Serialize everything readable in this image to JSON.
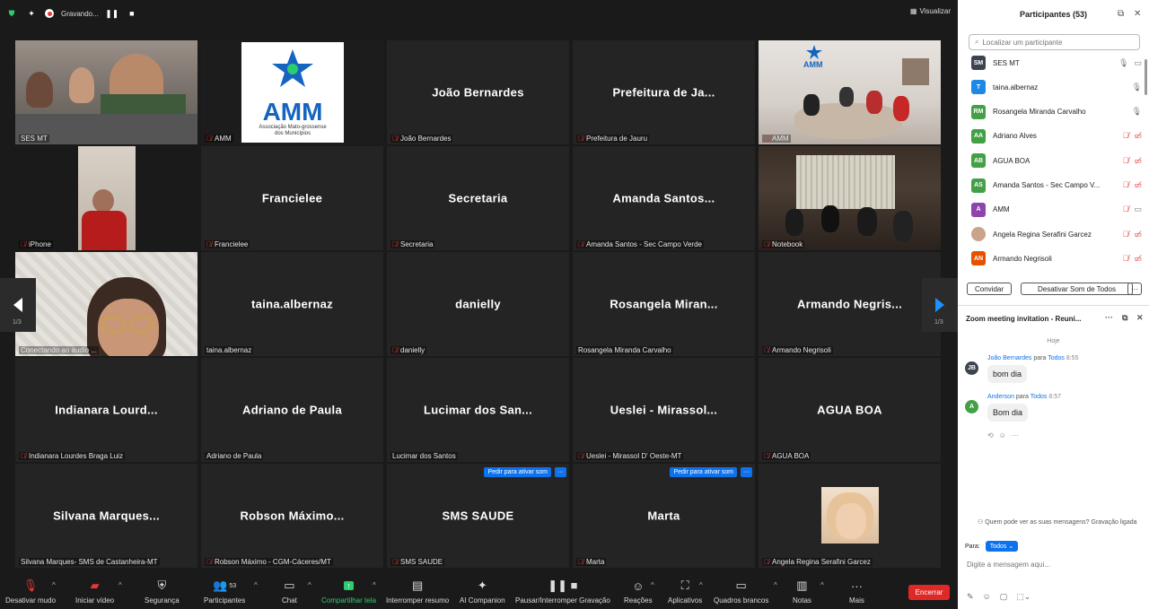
{
  "topbar": {
    "recording_label": "Gravando...",
    "view_label": "Visualizar"
  },
  "grid": {
    "tiles": [
      {
        "name": "",
        "label": "SES MT",
        "muted": false,
        "kind": "video-room"
      },
      {
        "name": "",
        "label": "AMM",
        "muted": true,
        "kind": "logo"
      },
      {
        "name": "João Bernardes",
        "label": "João Bernardes",
        "muted": true
      },
      {
        "name": "Prefeitura de Ja...",
        "label": "Prefeitura de Jauru",
        "muted": true
      },
      {
        "name": "",
        "label": "AMM",
        "muted": true,
        "kind": "video-office"
      },
      {
        "name": "",
        "label": "iPhone",
        "muted": true,
        "kind": "video-person"
      },
      {
        "name": "Francielee",
        "label": "Francielee",
        "muted": true
      },
      {
        "name": "Secretaria",
        "label": "Secretaria",
        "muted": true
      },
      {
        "name": "Amanda Santos...",
        "label": "Amanda Santos - Sec Campo Verde",
        "muted": true
      },
      {
        "name": "",
        "label": "Notebook",
        "muted": true,
        "kind": "video-dark"
      },
      {
        "name": "",
        "label": "Conectando ao áudio ...",
        "muted": false,
        "kind": "video-glasses"
      },
      {
        "name": "taina.albernaz",
        "label": "taina.albernaz",
        "muted": false
      },
      {
        "name": "danielly",
        "label": "danielly",
        "muted": true
      },
      {
        "name": "Rosangela Miran...",
        "label": "Rosangela Miranda Carvalho",
        "muted": false
      },
      {
        "name": "Armando Negris...",
        "label": "Armando Negrisoli",
        "muted": true
      },
      {
        "name": "Indianara Lourd...",
        "label": "Indianara Lourdes Braga Luiz",
        "muted": true
      },
      {
        "name": "Adriano de Paula",
        "label": "Adriano de Paula",
        "muted": false
      },
      {
        "name": "Lucimar dos San...",
        "label": "Lucimar dos Santos",
        "muted": false
      },
      {
        "name": "Ueslei - Mirassol...",
        "label": "Ueslei - Mirassol D' Oeste-MT",
        "muted": true
      },
      {
        "name": "AGUA BOA",
        "label": "AGUA BOA",
        "muted": true
      },
      {
        "name": "Silvana Marques...",
        "label": "Silvana Marques- SMS de Castanheira-MT",
        "muted": false
      },
      {
        "name": "Robson Máximo...",
        "label": "Robson Máximo - CGM-Cáceres/MT",
        "muted": true
      },
      {
        "name": "SMS SAUDE",
        "label": "SMS SAUDE",
        "muted": true,
        "request": true
      },
      {
        "name": "Marta",
        "label": "Marta",
        "muted": true,
        "request": true
      },
      {
        "name": "",
        "label": "Angela Regina Serafini Garcez",
        "muted": true,
        "kind": "photo"
      }
    ],
    "request_label": "Pedir para ativar som",
    "request_more": "···",
    "page_indicator": "1/3",
    "logo_text": "AMM",
    "logo_sub1": "Associação Mato-grossense",
    "logo_sub2": "dos Municípios"
  },
  "toolbar": {
    "mute": "Desativar mudo",
    "video": "Iniciar vídeo",
    "security": "Segurança",
    "participants": "Participantes",
    "participants_count": "53",
    "chat": "Chat",
    "share": "Compartilhar tela",
    "summary": "Interromper resumo",
    "companion": "AI Companion",
    "pause_recording": "Pausar/Interromper Gravação",
    "reactions": "Reações",
    "apps": "Aplicativos",
    "whiteboards": "Quadros brancos",
    "notes": "Notas",
    "more": "Mais",
    "end": "Encerrar"
  },
  "panel": {
    "title": "Participantes (53)",
    "search_placeholder": "Localizar um participante",
    "participants": [
      {
        "initials": "SM",
        "name": "SES MT",
        "color": "#3d4450",
        "mic": "on",
        "cam": "on"
      },
      {
        "initials": "T",
        "name": "taina.albernaz",
        "color": "#1e88e5",
        "mic": "on",
        "cam": ""
      },
      {
        "initials": "RM",
        "name": "Rosangela Miranda Carvalho",
        "color": "#43a047",
        "mic": "on",
        "cam": ""
      },
      {
        "initials": "AA",
        "name": "Adriano Alves",
        "color": "#43a047",
        "mic": "off",
        "cam": "off"
      },
      {
        "initials": "AB",
        "name": "AGUA BOA",
        "color": "#43a047",
        "mic": "off",
        "cam": "off"
      },
      {
        "initials": "AS",
        "name": "Amanda Santos - Sec Campo V...",
        "color": "#43a047",
        "mic": "off",
        "cam": "off"
      },
      {
        "initials": "A",
        "name": "AMM",
        "color": "#8e44ad",
        "mic": "off",
        "cam": "on"
      },
      {
        "initials": "",
        "name": "Angela Regina Serafini Garcez",
        "color": "#c9a38a",
        "mic": "off",
        "cam": "off"
      },
      {
        "initials": "AN",
        "name": "Armando Negrisoli",
        "color": "#e65100",
        "mic": "off",
        "cam": "off"
      }
    ],
    "invite": "Convidar",
    "mute_all": "Desativar Som de Todos",
    "more": "···"
  },
  "chat": {
    "title": "Zoom meeting invitation - Reuni...",
    "today": "Hoje",
    "messages": [
      {
        "initials": "JB",
        "color": "#3d4450",
        "sender": "João Bernardes",
        "to": "para",
        "to_who": "Todos",
        "time": "8:55",
        "text": "bom dia"
      },
      {
        "initials": "A",
        "color": "#43a047",
        "sender": "Anderson",
        "to": "para",
        "to_who": "Todos",
        "time": "8:57",
        "text": "Bom dia"
      }
    ],
    "who_can_see": "Quem pode ver as suas mensagens? Gravação ligada",
    "to_label": "Para:",
    "to_value": "Todos",
    "input_placeholder": "Digite a mensagem aqui..."
  }
}
